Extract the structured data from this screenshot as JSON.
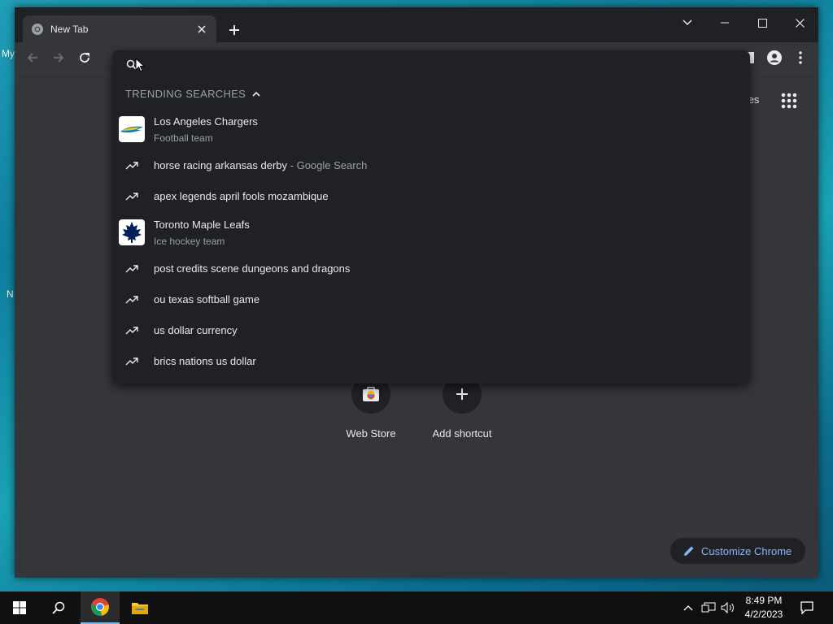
{
  "desktop": {
    "edge_text_top": "My",
    "edge_text_mid": "N"
  },
  "browser": {
    "tab_title": "New Tab",
    "images_link": "nages",
    "colors": {
      "accent": "#8ab4f8",
      "bg_dark": "#202124",
      "bg_mid": "#35363a",
      "text": "#e8eaed",
      "muted": "#9aa0a6"
    }
  },
  "omnibox": {
    "placeholder": "",
    "trending_header": "TRENDING SEARCHES",
    "suggestions": [
      {
        "type": "entity",
        "title": "Los Angeles Chargers",
        "subtitle": "Football team",
        "icon": "chargers-logo"
      },
      {
        "type": "trend",
        "title": "horse racing arkansas derby",
        "suffix": " - Google Search",
        "icon": "trending-up-icon"
      },
      {
        "type": "trend",
        "title": "apex legends april fools mozambique",
        "icon": "trending-up-icon"
      },
      {
        "type": "entity",
        "title": "Toronto Maple Leafs",
        "subtitle": "Ice hockey team",
        "icon": "maple-leafs-logo"
      },
      {
        "type": "trend",
        "title": "post credits scene dungeons and dragons",
        "icon": "trending-up-icon"
      },
      {
        "type": "trend",
        "title": "ou texas softball game",
        "icon": "trending-up-icon"
      },
      {
        "type": "trend",
        "title": "us dollar currency",
        "icon": "trending-up-icon"
      },
      {
        "type": "trend",
        "title": "brics nations us dollar",
        "icon": "trending-up-icon"
      }
    ]
  },
  "shortcuts": [
    {
      "label": "Web Store",
      "icon": "web-store-icon"
    },
    {
      "label": "Add shortcut",
      "icon": "plus-icon"
    }
  ],
  "customize_label": "Customize Chrome",
  "taskbar": {
    "time": "8:49 PM",
    "date": "4/2/2023"
  }
}
